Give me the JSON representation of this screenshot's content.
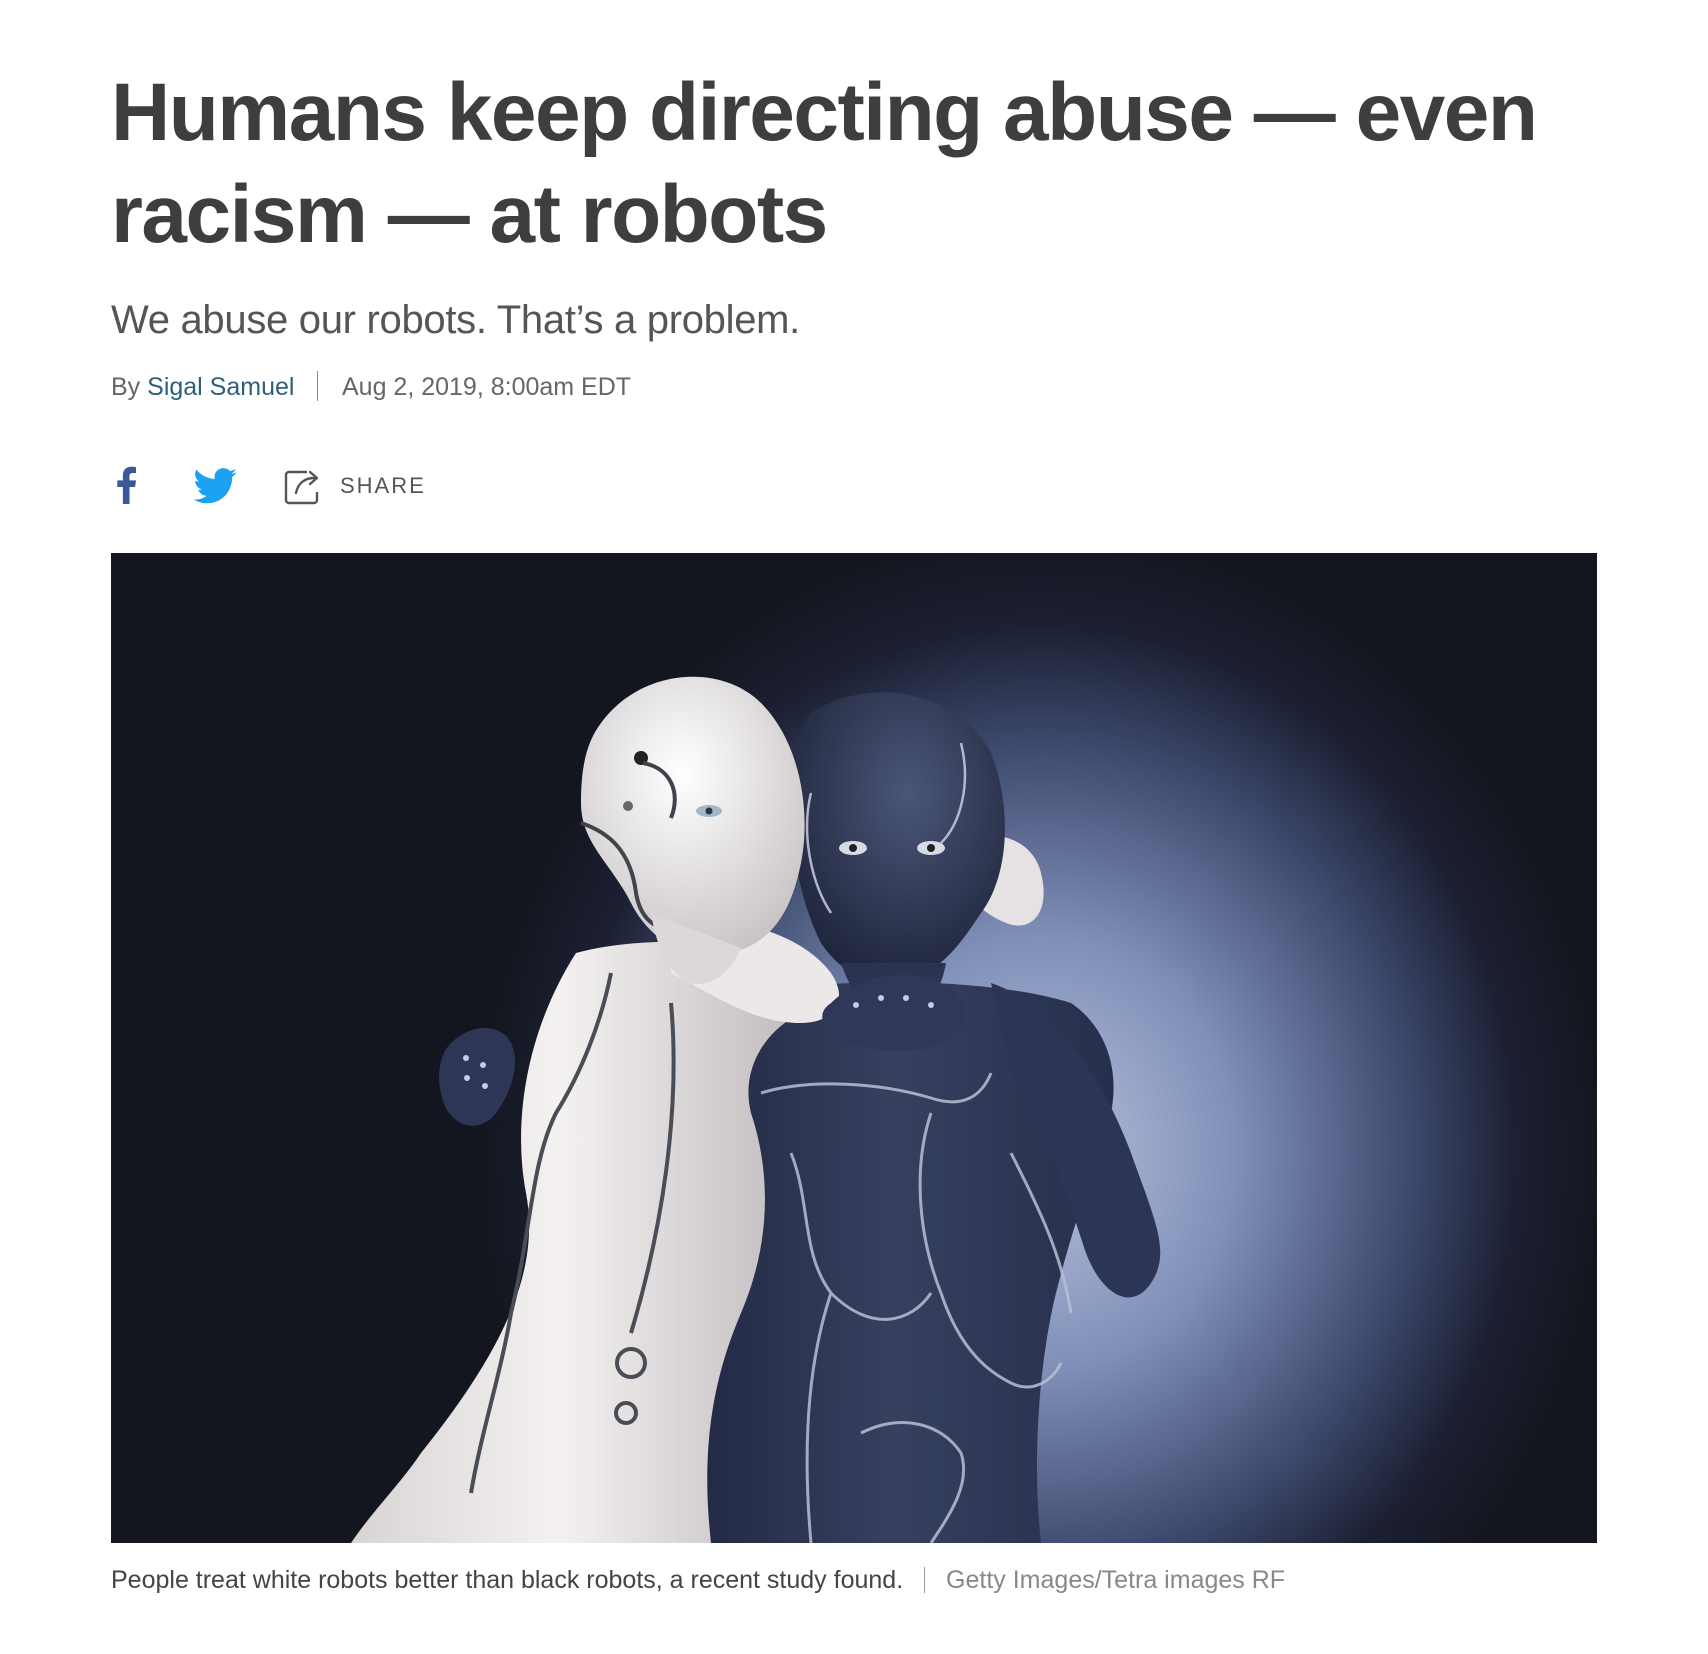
{
  "headline": "Humans keep directing abuse — even racism — at robots",
  "dek": "We abuse our robots. That’s a problem.",
  "byline": {
    "prefix": "By",
    "author": "Sigal Samuel",
    "date": "Aug 2, 2019, 8:00am EDT"
  },
  "share": {
    "facebook_icon": "facebook-icon",
    "twitter_icon": "twitter-icon",
    "share_icon": "share-icon",
    "share_label": "SHARE",
    "facebook_color": "#3b5998",
    "twitter_color": "#1da1f2"
  },
  "image": {
    "caption": "People treat white robots better than black robots, a recent study found.",
    "credit": "Getty Images/Tetra images RF"
  }
}
